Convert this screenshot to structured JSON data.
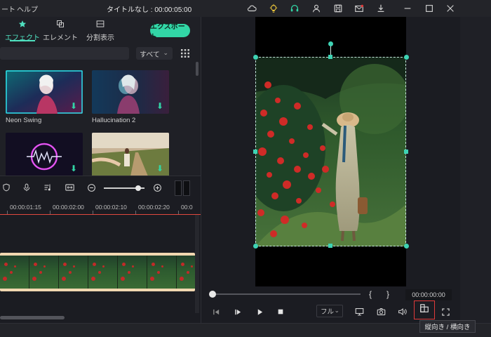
{
  "menu": {
    "partial_item": "ート",
    "help": "ヘルプ"
  },
  "window_title": "タイトルなし : 00:00:05:00",
  "library": {
    "tabs": [
      {
        "label": "エフェクト",
        "icon": "star-icon",
        "active": true
      },
      {
        "label": "エレメント",
        "icon": "layers-icon",
        "active": false
      },
      {
        "label": "分割表示",
        "icon": "split-screen-icon",
        "active": false
      }
    ],
    "export_label": "エクスポート",
    "filter": {
      "selected": "すべて"
    },
    "items": [
      {
        "label": "Neon Swing"
      },
      {
        "label": "Hallucination 2"
      },
      {
        "label": ""
      },
      {
        "label": ""
      }
    ]
  },
  "timeline": {
    "ruler_labels": [
      "00:00:01:15",
      "00:00:02:00",
      "00:00:02:10",
      "00:00:02:20",
      "00:0"
    ],
    "zoom_level": 0.85
  },
  "player": {
    "timecode": "00:00:00:00",
    "brace_open": "{",
    "brace_close": "}",
    "quality": "フル",
    "aspect_tooltip": "縦向き / 横向き"
  },
  "colors": {
    "accent": "#32d6a6",
    "playhead": "#e0483e",
    "highlight": "#e03a3a"
  }
}
